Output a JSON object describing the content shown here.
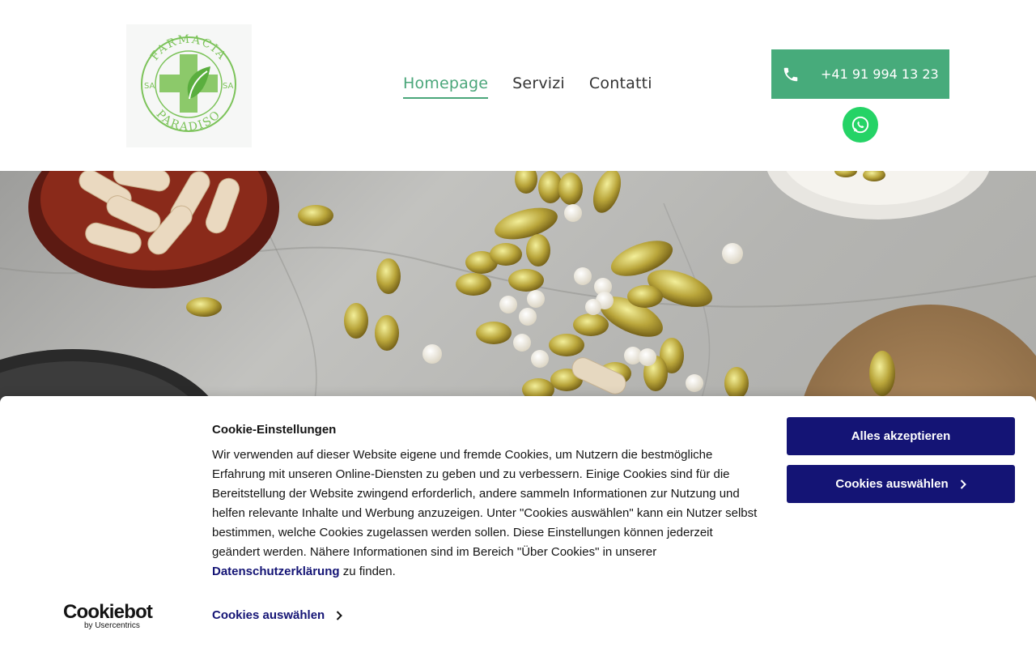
{
  "header": {
    "logo": {
      "top_text": "FARMACIA",
      "bottom_text": "PARADISO",
      "left_tag": "SA",
      "right_tag": "SA",
      "color": "#7cc35a"
    },
    "nav": [
      {
        "label": "Homepage",
        "active": true
      },
      {
        "label": "Servizi",
        "active": false
      },
      {
        "label": "Contatti",
        "active": false
      }
    ],
    "phone": {
      "number": "+41 91 994 13 23",
      "icon": "phone-icon",
      "color": "#47ab7b"
    },
    "whatsapp": {
      "icon": "whatsapp-icon",
      "color": "#25d366"
    }
  },
  "hero": {
    "image": "pills-and-capsules-on-marble"
  },
  "cookie_banner": {
    "title": "Cookie-Einstellungen",
    "body": "Wir verwenden auf dieser Website eigene und fremde Cookies, um Nutzern die bestmögliche Erfahrung mit unseren Online-Diensten zu geben und zu verbessern. Einige Cookies sind für die Bereitstellung der Website zwingend erforderlich, andere sammeln Informationen zur Nutzung und helfen relevante Inhalte und Werbung anzuzeigen. Unter \"Cookies auswählen\" kann ein Nutzer selbst bestimmen, welche Cookies zugelassen werden sollen. Diese Einstellungen können jederzeit geändert werden. Nähere Informationen sind im Bereich \"Über Cookies\" in unserer ",
    "link_text": "Datenschutzerklärung",
    "body_end": " zu finden.",
    "choose_link": "Cookies auswählen",
    "accept_button": "Alles akzeptieren",
    "select_button": "Cookies auswählen",
    "brand": "Cookiebot",
    "brand_sub": "by Usercentrics",
    "accent_color": "#141475"
  }
}
